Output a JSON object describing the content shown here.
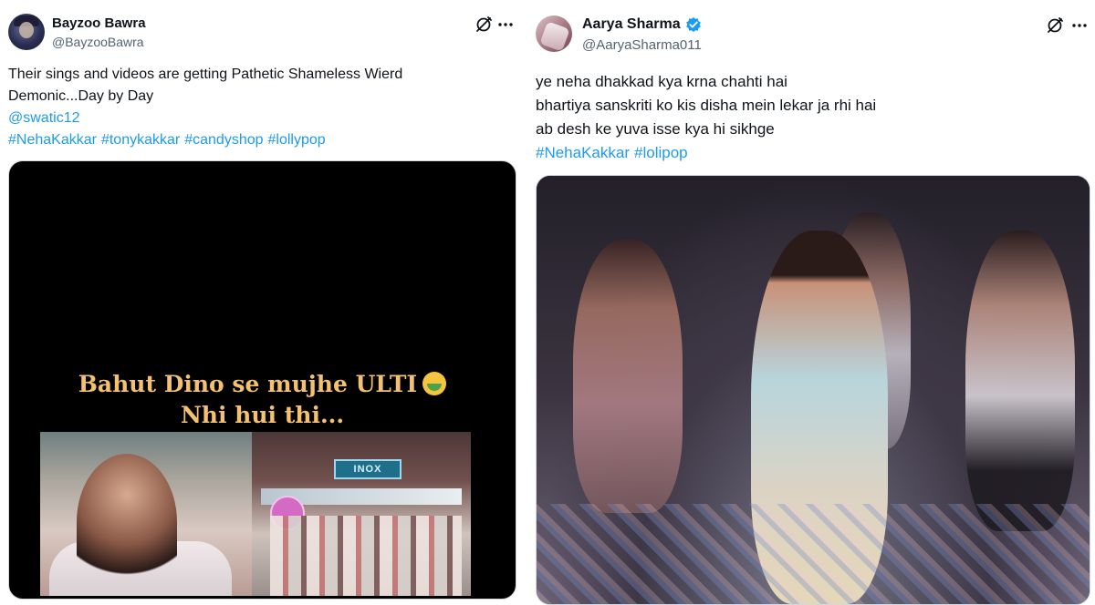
{
  "left_tweet": {
    "author_name": "Bayzoo Bawra",
    "author_handle": "@BayzooBawra",
    "text_line1": "Their sings and videos are getting Pathetic Shameless Wierd",
    "text_line2": "Demonic...Day by Day",
    "mention": "@swatic12",
    "hashtags": [
      "#NehaKakkar",
      "#tonykakkar",
      "#candyshop",
      "#lollypop"
    ],
    "media": {
      "caption_line1": "Bahut Dino se mujhe ULTI",
      "caption_line2": "Nhi hui thi...",
      "caption_emoji": "nauseated-face-emoji",
      "sign_text": "INOX"
    }
  },
  "right_tweet": {
    "author_name": "Aarya Sharma",
    "author_handle": "@AaryaSharma011",
    "verified": true,
    "lines": [
      "ye neha dhakkad kya krna chahti hai",
      "bhartiya sanskriti ko kis disha mein lekar ja rhi hai",
      "ab desh ke yuva isse kya hi sikhge"
    ],
    "hashtags": [
      "#NehaKakkar",
      "#lolipop"
    ]
  },
  "icons": {
    "grok": "grok-icon",
    "more": "more-icon",
    "verified": "verified-badge-icon"
  },
  "colors": {
    "link": "#1d9bf0",
    "text": "#0f1419",
    "secondary": "#536471",
    "caption": "#f3c170"
  }
}
